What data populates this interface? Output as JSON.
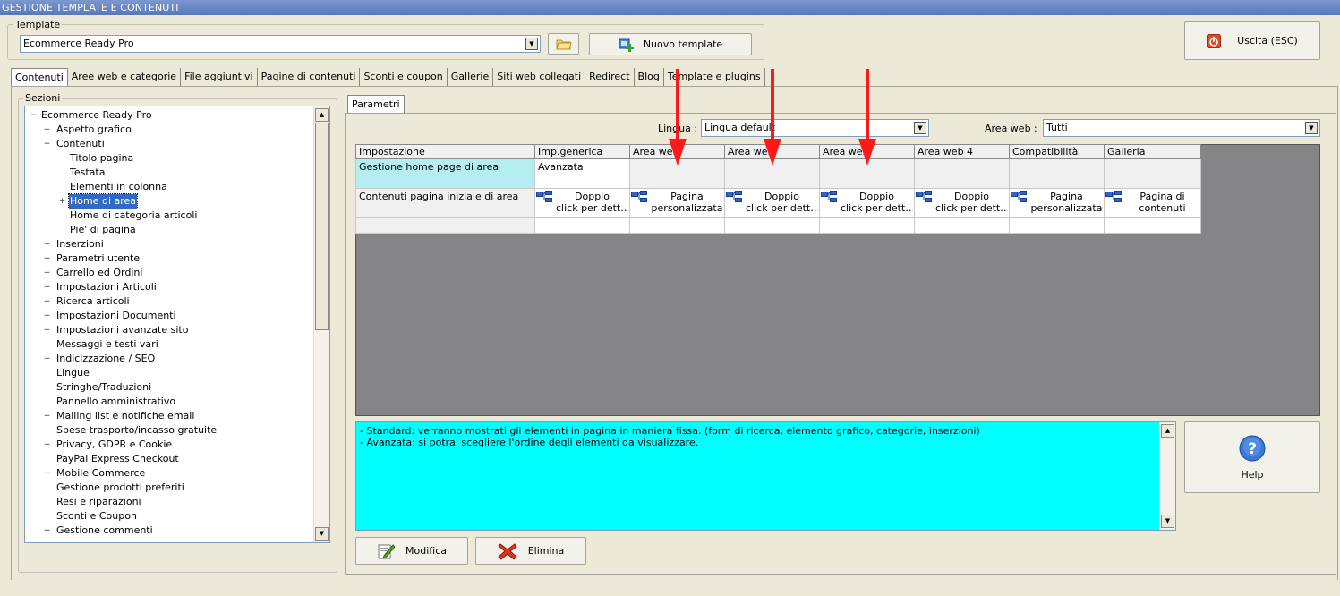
{
  "window": {
    "title": "GESTIONE TEMPLATE E CONTENUTI"
  },
  "template_group": {
    "legend": "Template",
    "selected": "Ecommerce Ready Pro",
    "new_button": "Nuovo template"
  },
  "exit_button": "Uscita (ESC)",
  "tabs": [
    {
      "label": "Contenuti",
      "active": true
    },
    {
      "label": "Aree web e categorie"
    },
    {
      "label": "File aggiuntivi"
    },
    {
      "label": "Pagine di contenuti"
    },
    {
      "label": "Sconti e coupon"
    },
    {
      "label": "Gallerie"
    },
    {
      "label": "Siti web collegati"
    },
    {
      "label": "Redirect"
    },
    {
      "label": "Blog"
    },
    {
      "label": "Template e plugins"
    }
  ],
  "sections": {
    "legend": "Sezioni",
    "items": [
      {
        "label": "Ecommerce Ready Pro",
        "level": 0,
        "exp": "−"
      },
      {
        "label": "Aspetto grafico",
        "level": 1,
        "exp": "+"
      },
      {
        "label": "Contenuti",
        "level": 1,
        "exp": "−"
      },
      {
        "label": "Titolo pagina",
        "level": 2,
        "exp": ""
      },
      {
        "label": "Testata",
        "level": 2,
        "exp": ""
      },
      {
        "label": "Elementi in colonna",
        "level": 2,
        "exp": ""
      },
      {
        "label": "Home di area",
        "level": 2,
        "exp": "+",
        "selected": true
      },
      {
        "label": "Home di categoria articoli",
        "level": 2,
        "exp": ""
      },
      {
        "label": "Pie' di pagina",
        "level": 2,
        "exp": ""
      },
      {
        "label": "Inserzioni",
        "level": 1,
        "exp": "+"
      },
      {
        "label": "Parametri utente",
        "level": 1,
        "exp": "+"
      },
      {
        "label": "Carrello ed Ordini",
        "level": 1,
        "exp": "+"
      },
      {
        "label": "Impostazioni Articoli",
        "level": 1,
        "exp": "+"
      },
      {
        "label": "Ricerca articoli",
        "level": 1,
        "exp": "+"
      },
      {
        "label": "Impostazioni Documenti",
        "level": 1,
        "exp": "+"
      },
      {
        "label": "Impostazioni avanzate sito",
        "level": 1,
        "exp": "+"
      },
      {
        "label": "Messaggi e testi vari",
        "level": 1,
        "exp": ""
      },
      {
        "label": "Indicizzazione / SEO",
        "level": 1,
        "exp": "+"
      },
      {
        "label": "Lingue",
        "level": 1,
        "exp": ""
      },
      {
        "label": "Stringhe/Traduzioni",
        "level": 1,
        "exp": ""
      },
      {
        "label": "Pannello amministrativo",
        "level": 1,
        "exp": ""
      },
      {
        "label": "Mailing list e notifiche email",
        "level": 1,
        "exp": "+"
      },
      {
        "label": "Spese trasporto/incasso gratuite",
        "level": 1,
        "exp": ""
      },
      {
        "label": "Privacy, GDPR e Cookie",
        "level": 1,
        "exp": "+"
      },
      {
        "label": "PayPal Express Checkout",
        "level": 1,
        "exp": ""
      },
      {
        "label": "Mobile Commerce",
        "level": 1,
        "exp": "+"
      },
      {
        "label": "Gestione prodotti preferiti",
        "level": 1,
        "exp": ""
      },
      {
        "label": "Resi e riparazioni",
        "level": 1,
        "exp": ""
      },
      {
        "label": "Sconti e Coupon",
        "level": 1,
        "exp": ""
      },
      {
        "label": "Gestione commenti",
        "level": 1,
        "exp": "+"
      }
    ]
  },
  "params": {
    "tab": "Parametri",
    "lingua_label": "Lingua :",
    "lingua_value": "Lingua default",
    "area_label": "Area web :",
    "area_value": "Tutti",
    "columns": [
      "Impostazione",
      "Imp.generica",
      "Area web",
      "Area web",
      "Area web",
      "Area web 4",
      "Compatibilità",
      "Galleria"
    ],
    "rows": [
      {
        "setting": "Gestione home page di area",
        "cells": [
          "Avanzata",
          "",
          "",
          "",
          "",
          "",
          ""
        ]
      },
      {
        "setting": "Contenuti pagina iniziale di area",
        "cells": [
          [
            "Doppio",
            "click per dett…"
          ],
          [
            "Pagina",
            "personalizzata"
          ],
          [
            "Doppio",
            "click per dett…"
          ],
          [
            "Doppio",
            "click per dett…"
          ],
          [
            "Doppio",
            "click per dett…"
          ],
          [
            "Pagina",
            "personalizzata"
          ],
          [
            "Pagina di",
            "contenuti"
          ]
        ]
      }
    ]
  },
  "description": [
    "- Standard: verranno mostrati gli elementi in pagina in maniera fissa. (form di ricerca, elemento grafico, categorie, inserzioni)",
    "- Avanzata: si potra' scegliere l'ordine degli elementi da visualizzare."
  ],
  "help_button": "Help",
  "modify_button": "Modifica",
  "delete_button": "Elimina",
  "colors": {
    "description_bg": "#00ffff",
    "selected_cell": "#b4eef0",
    "grid_bg": "#858487",
    "arrow": "#ff0000"
  }
}
